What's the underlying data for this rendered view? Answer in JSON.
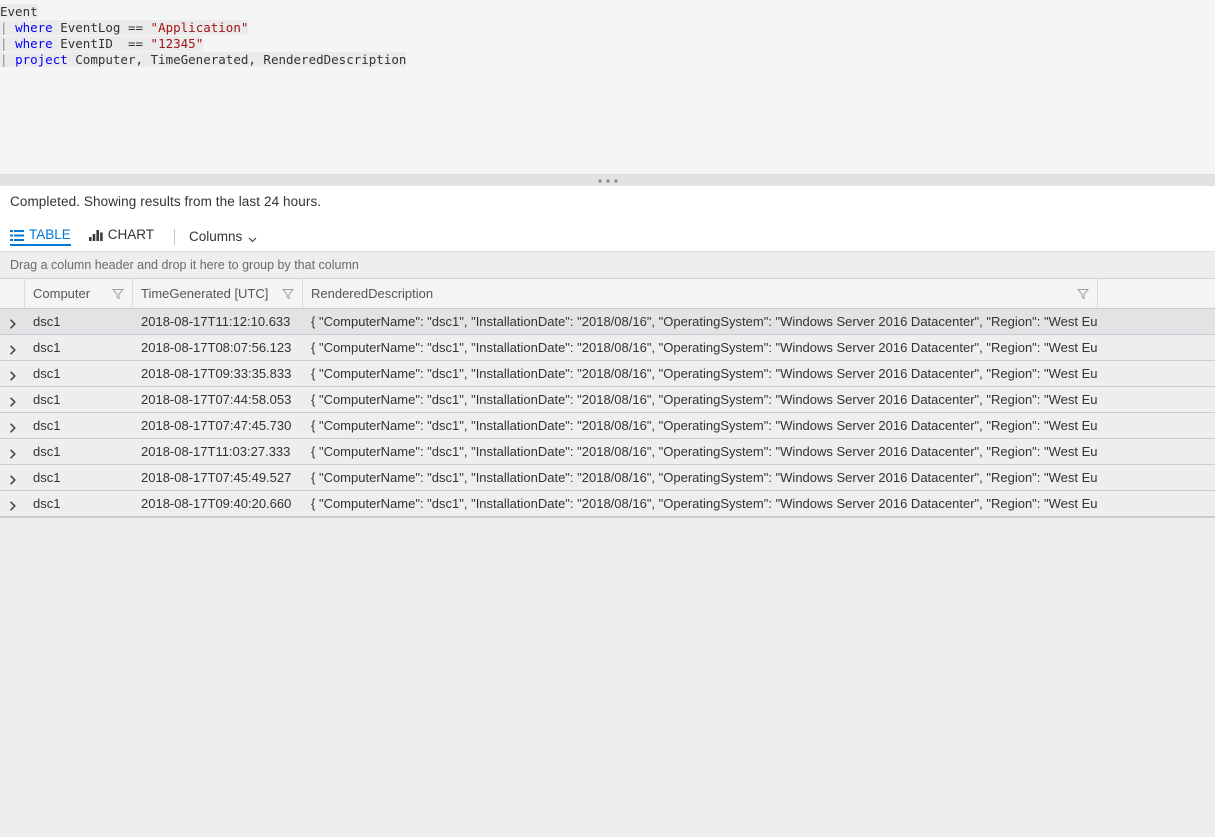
{
  "editor": {
    "lines": [
      {
        "tokens": [
          {
            "t": "Event",
            "c": "tok-table"
          }
        ]
      },
      {
        "tokens": [
          {
            "t": "| ",
            "c": "tok-pipe"
          },
          {
            "t": "where",
            "c": "tok-kw"
          },
          {
            "t": " EventLog == ",
            "c": "tok-plain"
          },
          {
            "t": "\"Application\"",
            "c": "tok-str"
          }
        ]
      },
      {
        "tokens": [
          {
            "t": "| ",
            "c": "tok-pipe"
          },
          {
            "t": "where",
            "c": "tok-kw"
          },
          {
            "t": " EventID  == ",
            "c": "tok-plain"
          },
          {
            "t": "\"12345\"",
            "c": "tok-str"
          }
        ]
      },
      {
        "tokens": [
          {
            "t": "| ",
            "c": "tok-pipe"
          },
          {
            "t": "project",
            "c": "tok-kw"
          },
          {
            "t": " Computer, TimeGenerated, RenderedDescription",
            "c": "tok-plain"
          }
        ]
      }
    ]
  },
  "splitter": {
    "grip_dots": 3
  },
  "results": {
    "status": "Completed. Showing results from the last 24 hours.",
    "toolbar": {
      "table_label": "TABLE",
      "table_icon": "table-rows-icon",
      "chart_label": "CHART",
      "chart_icon": "bar-chart-icon",
      "columns_label": "Columns",
      "columns_icon": "chevron-down-icon",
      "active_view": "TABLE",
      "accent_color": "#0078d4"
    },
    "group_bar_text": "Drag a column header and drop it here to group by that column"
  },
  "grid": {
    "columns": [
      {
        "key": "computer",
        "label": "Computer",
        "filter": true
      },
      {
        "key": "time",
        "label": "TimeGenerated [UTC]",
        "filter": true
      },
      {
        "key": "desc",
        "label": "RenderedDescription",
        "filter": true
      }
    ],
    "expander_glyph": "chevron-right-icon",
    "rows": [
      {
        "computer": "dsc1",
        "time": "2018-08-17T11:12:10.633",
        "desc": "{ \"ComputerName\": \"dsc1\", \"InstallationDate\": \"2018/08/16\", \"OperatingSystem\": \"Windows Server 2016 Datacenter\", \"Region\": \"West Europe\" }"
      },
      {
        "computer": "dsc1",
        "time": "2018-08-17T08:07:56.123",
        "desc": "{ \"ComputerName\": \"dsc1\", \"InstallationDate\": \"2018/08/16\", \"OperatingSystem\": \"Windows Server 2016 Datacenter\", \"Region\": \"West Europe\" }"
      },
      {
        "computer": "dsc1",
        "time": "2018-08-17T09:33:35.833",
        "desc": "{ \"ComputerName\": \"dsc1\", \"InstallationDate\": \"2018/08/16\", \"OperatingSystem\": \"Windows Server 2016 Datacenter\", \"Region\": \"West Europe\" }"
      },
      {
        "computer": "dsc1",
        "time": "2018-08-17T07:44:58.053",
        "desc": "{ \"ComputerName\": \"dsc1\", \"InstallationDate\": \"2018/08/16\", \"OperatingSystem\": \"Windows Server 2016 Datacenter\", \"Region\": \"West Europe\" }"
      },
      {
        "computer": "dsc1",
        "time": "2018-08-17T07:47:45.730",
        "desc": "{ \"ComputerName\": \"dsc1\", \"InstallationDate\": \"2018/08/16\", \"OperatingSystem\": \"Windows Server 2016 Datacenter\", \"Region\": \"West Europe\" }"
      },
      {
        "computer": "dsc1",
        "time": "2018-08-17T11:03:27.333",
        "desc": "{ \"ComputerName\": \"dsc1\", \"InstallationDate\": \"2018/08/16\", \"OperatingSystem\": \"Windows Server 2016 Datacenter\", \"Region\": \"West Europe\" }"
      },
      {
        "computer": "dsc1",
        "time": "2018-08-17T07:45:49.527",
        "desc": "{ \"ComputerName\": \"dsc1\", \"InstallationDate\": \"2018/08/16\", \"OperatingSystem\": \"Windows Server 2016 Datacenter\", \"Region\": \"West Europe\" }"
      },
      {
        "computer": "dsc1",
        "time": "2018-08-17T09:40:20.660",
        "desc": "{ \"ComputerName\": \"dsc1\", \"InstallationDate\": \"2018/08/16\", \"OperatingSystem\": \"Windows Server 2016 Datacenter\", \"Region\": \"West Europe\" }"
      }
    ],
    "hovered_row_index": 0
  }
}
